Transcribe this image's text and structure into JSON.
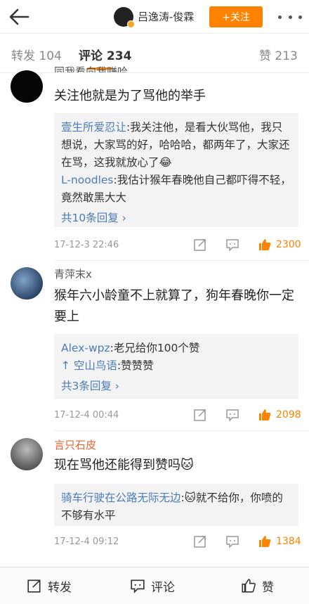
{
  "header": {
    "username": "吕逸涛-俊霖",
    "follow_label": "+关注"
  },
  "tabs": {
    "repost": "转发 104",
    "comment": "评论 234",
    "like": "赞 213"
  },
  "comments": [
    {
      "name": "同我看向我赚哈",
      "text": "关注他就是为了骂他的举手",
      "replies": [
        {
          "name": "壹生所爱忍让",
          "text": ":我关注他，是看大伙骂他，我只想说，大家骂的好，哈哈哈，都两年了，大家还在骂，这我就放心了😂"
        },
        {
          "name": "L-noodles",
          "text": ":我估计猴年春晚他自己都吓得不轻，竟然敢黑大大"
        }
      ],
      "more_replies": "共10条回复 ›",
      "date": "17-12-3 22:46",
      "likes": "2300"
    },
    {
      "name": "青萍末x",
      "text": "猴年六小龄童不上就算了，狗年春晚你一定要上",
      "replies": [
        {
          "name": "Alex-wpz",
          "text": ":老兄给你100个赞"
        },
        {
          "name": "↑ 空山鸟语",
          "text": ":赞赞赞"
        }
      ],
      "more_replies": "共3条回复 ›",
      "date": "17-12-4 00:44",
      "likes": "2098"
    },
    {
      "name": "言只石皮",
      "text": "现在骂他还能得到赞吗🐱",
      "replies": [
        {
          "name": "骑车行驶在公路无际无边",
          "text": ":🐱就不给你，你喷的不够有水平"
        }
      ],
      "more_replies": "",
      "date": "17-12-4 09:12",
      "likes": "1384"
    }
  ],
  "bottom_bar": {
    "repost": "转发",
    "comment": "评论",
    "like": "赞"
  },
  "colors": {
    "accent": "#ff8200",
    "link": "#4b7bb5"
  }
}
